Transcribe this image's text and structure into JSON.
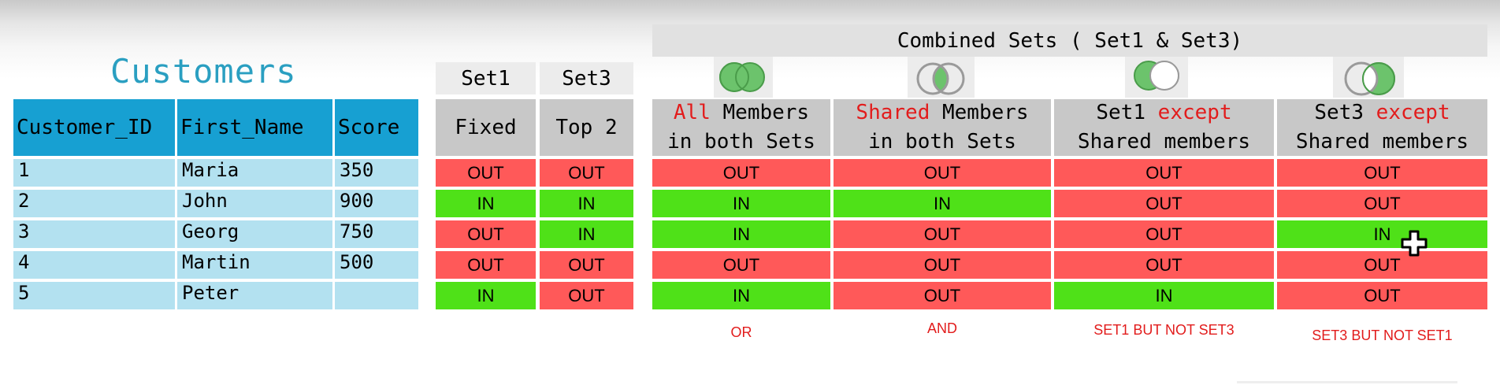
{
  "customers_title": "Customers",
  "customers_table": {
    "headers": [
      "Customer_ID",
      "First_Name",
      "Score"
    ],
    "rows": [
      [
        "1",
        "Maria",
        "350"
      ],
      [
        "2",
        "John",
        "900"
      ],
      [
        "3",
        "Georg",
        "750"
      ],
      [
        "4",
        "Martin",
        "500"
      ],
      [
        "5",
        "Peter",
        ""
      ]
    ]
  },
  "sets": {
    "set1": {
      "label": "Set1",
      "header": "Fixed"
    },
    "set3": {
      "label": "Set3",
      "header": "Top 2"
    }
  },
  "combined_title": "Combined Sets ( Set1 & Set3)",
  "combined_columns": [
    {
      "line1_highlight": "All",
      "line1_rest": " Members",
      "line2": "in both Sets",
      "op_label": "OR"
    },
    {
      "line1_highlight": "Shared",
      "line1_rest": " Members",
      "line2": "in both Sets",
      "op_label": "AND"
    },
    {
      "line1_prefix": "Set1 ",
      "line1_highlight": "except",
      "line2": "Shared members",
      "op_label": "SET1 BUT NOT SET3"
    },
    {
      "line1_prefix": "Set3 ",
      "line1_highlight": "except",
      "line2": "Shared members",
      "op_label": "SET3 BUT NOT SET1"
    }
  ],
  "membership": {
    "set1": [
      "OUT",
      "IN",
      "OUT",
      "OUT",
      "IN"
    ],
    "set3": [
      "OUT",
      "IN",
      "IN",
      "OUT",
      "OUT"
    ],
    "combined": [
      [
        "OUT",
        "OUT",
        "OUT",
        "OUT"
      ],
      [
        "IN",
        "IN",
        "OUT",
        "OUT"
      ],
      [
        "IN",
        "OUT",
        "OUT",
        "IN"
      ],
      [
        "OUT",
        "OUT",
        "OUT",
        "OUT"
      ],
      [
        "IN",
        "OUT",
        "IN",
        "OUT"
      ]
    ]
  },
  "colors": {
    "in": "#4fe118",
    "out": "#ff5959",
    "header_blue": "#17a0d2",
    "cell_blue": "#b3e1f0",
    "highlight_red": "#e21c1c",
    "venn_green": "#6cc36c"
  },
  "venn_icons": [
    "venn-union-icon",
    "venn-intersection-icon",
    "venn-left-only-icon",
    "venn-right-only-icon"
  ],
  "cursor_icon": "move-cursor-icon"
}
